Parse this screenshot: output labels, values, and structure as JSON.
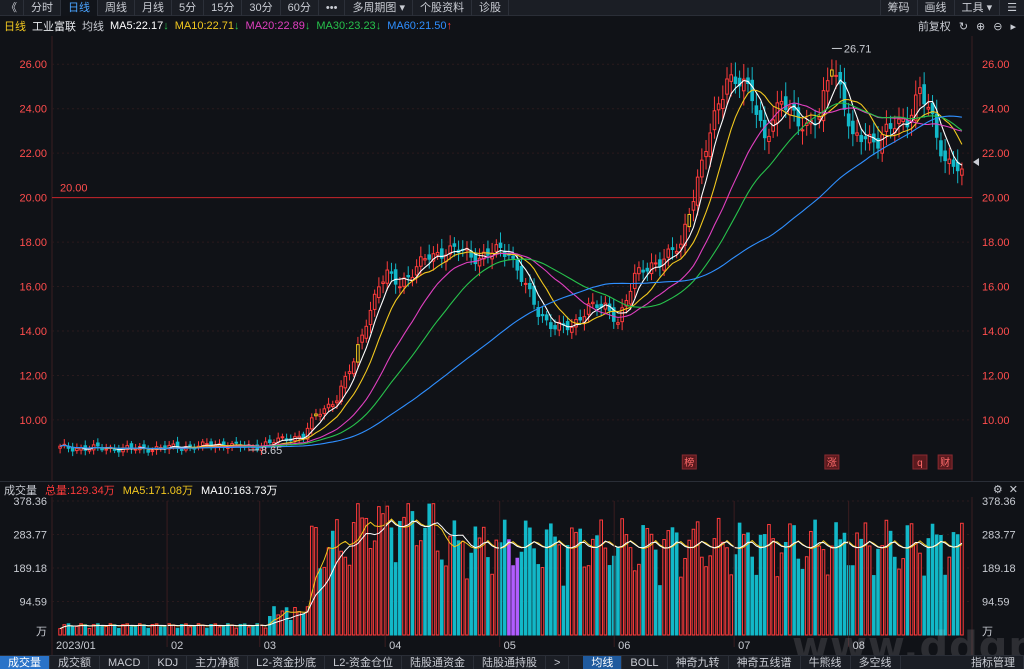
{
  "toolbar": {
    "items": [
      {
        "label": "《",
        "active": false
      },
      {
        "label": "分时",
        "active": false
      },
      {
        "label": "日线",
        "active": true
      },
      {
        "label": "周线",
        "active": false
      },
      {
        "label": "月线",
        "active": false
      },
      {
        "label": "5分",
        "active": false
      },
      {
        "label": "15分",
        "active": false
      },
      {
        "label": "30分",
        "active": false
      },
      {
        "label": "60分",
        "active": false
      },
      {
        "label": "•••",
        "active": false
      },
      {
        "label": "多周期图 ▾",
        "active": false
      },
      {
        "label": "个股资料",
        "active": false
      },
      {
        "label": "诊股",
        "active": false
      }
    ],
    "right_items": [
      "筹码",
      "画线",
      "工具 ▾",
      "☰"
    ]
  },
  "info": {
    "period": "日线",
    "name": "工业富联",
    "ma_label": "均线",
    "ma5": "MA5:22.17",
    "ma10": "MA10:22.71",
    "ma20": "MA20:22.89",
    "ma30": "MA30:23.23",
    "ma60": "MA60:21.50",
    "ma5_arrow": "↓",
    "ma10_arrow": "↓",
    "ma20_arrow": "↓",
    "ma30_arrow": "↓",
    "ma60_arrow": "↑",
    "adjust": "前复权",
    "icons": [
      "↻",
      "⊕",
      "⊖",
      "▸"
    ]
  },
  "colors": {
    "up": "#ff3b3b",
    "down": "#12b8c8",
    "ma5": "#ffffff",
    "ma10": "#f2c81f",
    "ma20": "#e040c0",
    "ma30": "#27c24c",
    "ma60": "#2f8fff",
    "axis": "#ff4d4d"
  },
  "chart_data": {
    "type": "candlestick",
    "title": "工业富联 日线",
    "price_axis": [
      26.0,
      24.0,
      22.0,
      20.0,
      18.0,
      16.0,
      14.0,
      12.0,
      10.0
    ],
    "ylim": [
      8.0,
      27.0
    ],
    "months": [
      "2023/01",
      "02",
      "03",
      "04",
      "05",
      "06",
      "07",
      "08"
    ],
    "reference_line": {
      "value": 20.0,
      "label": "20.00"
    },
    "high_label": "26.71",
    "low_label": "8.65",
    "events": [
      "榜",
      "涨",
      "q",
      "财"
    ],
    "close_series_anchor": [
      [
        0,
        8.75
      ],
      [
        10,
        8.72
      ],
      [
        20,
        8.7
      ],
      [
        30,
        8.8
      ],
      [
        40,
        8.9
      ],
      [
        45,
        8.75
      ],
      [
        55,
        9.2
      ],
      [
        58,
        9.3
      ],
      [
        61,
        10.2
      ],
      [
        63,
        10.5
      ],
      [
        66,
        11.0
      ],
      [
        70,
        12.6
      ],
      [
        73,
        14.5
      ],
      [
        76,
        16.0
      ],
      [
        78,
        16.5
      ],
      [
        81,
        16.2
      ],
      [
        84,
        16.6
      ],
      [
        88,
        17.4
      ],
      [
        92,
        17.6
      ],
      [
        96,
        17.6
      ],
      [
        100,
        17.3
      ],
      [
        104,
        17.6
      ],
      [
        107,
        17.6
      ],
      [
        110,
        16.4
      ],
      [
        114,
        14.8
      ],
      [
        118,
        14.2
      ],
      [
        122,
        14.1
      ],
      [
        126,
        15.2
      ],
      [
        130,
        15.0
      ],
      [
        133,
        14.5
      ],
      [
        137,
        16.4
      ],
      [
        141,
        17.0
      ],
      [
        145,
        17.4
      ],
      [
        148,
        17.8
      ],
      [
        150,
        19.5
      ],
      [
        153,
        21.5
      ],
      [
        156,
        23.5
      ],
      [
        159,
        25.5
      ],
      [
        162,
        25.2
      ],
      [
        165,
        24.5
      ],
      [
        168,
        22.8
      ],
      [
        172,
        24.2
      ],
      [
        175,
        23.8
      ],
      [
        178,
        23.2
      ],
      [
        181,
        23.5
      ],
      [
        184,
        26.2
      ],
      [
        186,
        25.0
      ],
      [
        189,
        22.5
      ],
      [
        192,
        22.8
      ],
      [
        195,
        22.6
      ],
      [
        199,
        23.2
      ],
      [
        202,
        23.6
      ],
      [
        205,
        24.8
      ],
      [
        208,
        23.4
      ],
      [
        211,
        21.7
      ],
      [
        213,
        21.6
      ],
      [
        215,
        20.9
      ]
    ],
    "ma_last": {
      "MA5": 22.17,
      "MA10": 22.71,
      "MA20": 22.89,
      "MA30": 23.23,
      "MA60": 21.5
    }
  },
  "volume": {
    "label": "成交量",
    "total": "总量:129.34万",
    "ma5": "MA5:171.08万",
    "ma10": "MA10:163.73万",
    "axis": [
      "378.36",
      "283.77",
      "189.18",
      "94.59",
      "万"
    ],
    "ylim": [
      0,
      378.36
    ],
    "unit": "万"
  },
  "bottom_tabs": {
    "left": [
      "成交量",
      "成交额",
      "MACD",
      "KDJ",
      "主力净额",
      "L2-资金抄底",
      "L2-资金仓位",
      "陆股通资金",
      "陆股通持股",
      ">"
    ],
    "right": [
      "均线",
      "BOLL",
      "神奇九转",
      "神奇五线谱",
      "牛熊线",
      "多空线"
    ],
    "end": "指标管理"
  },
  "watermark": "www.ddgp.net"
}
